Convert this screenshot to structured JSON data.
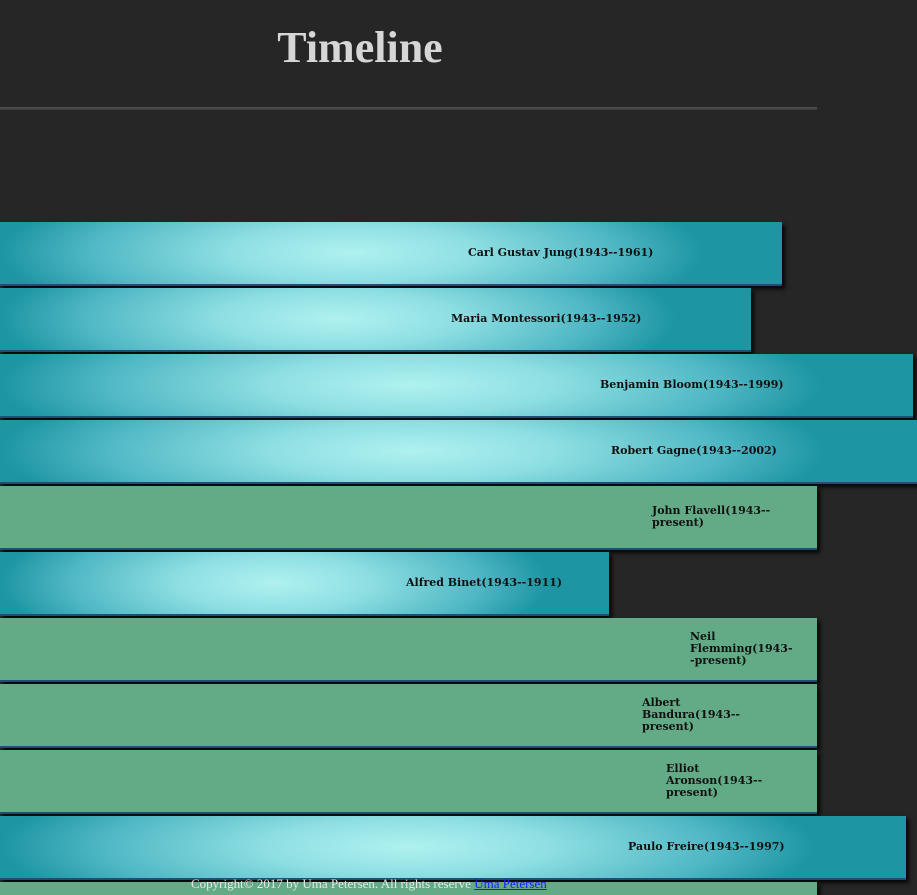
{
  "page": {
    "title": "Timeline"
  },
  "timeline": {
    "items": [
      {
        "label": "Carl Gustav Jung(1943--1961)",
        "style": "gradient"
      },
      {
        "label": "Maria Montessori(1943--1952)",
        "style": "gradient"
      },
      {
        "label": "Benjamin Bloom(1943--1999)",
        "style": "gradient"
      },
      {
        "label": "Robert Gagne(1943--2002)",
        "style": "gradient"
      },
      {
        "label": "John Flavell(1943--present)",
        "style": "solid"
      },
      {
        "label": "Alfred Binet(1943--1911)",
        "style": "gradient"
      },
      {
        "label": "Neil Flemming(1943--present)",
        "style": "solid"
      },
      {
        "label": "Albert Bandura(1943--present)",
        "style": "solid"
      },
      {
        "label": "Elliot Aronson(1943--present)",
        "style": "solid"
      },
      {
        "label": "Paulo Freire(1943--1997)",
        "style": "gradient"
      },
      {
        "label": "",
        "style": "solid"
      }
    ]
  },
  "footer": {
    "copyright": "Copyright© 2017 by Uma Petersen. All rights reserve",
    "link_text": "Uma Petersen"
  },
  "colors": {
    "background": "#262626",
    "title": "#d6d6d6",
    "solid_bar": "#63ab86",
    "gradient_light": "#b0f1f1",
    "gradient_dark": "#1d95a3",
    "bar_border": "#1f4f73",
    "link": "#1a1aff"
  }
}
